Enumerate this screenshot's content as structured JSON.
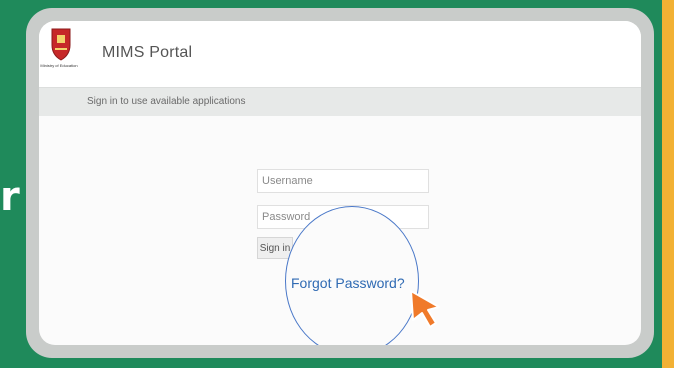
{
  "colors": {
    "background_green": "#1f8a5b",
    "accent_orange": "#f2b134",
    "link_blue": "#2f6ab3",
    "cursor_orange": "#f07a2a"
  },
  "header": {
    "logo_text": "Ministry of Education",
    "portal_title": "MIMS Portal"
  },
  "subbar": {
    "text": "Sign in to use available applications"
  },
  "login": {
    "username_placeholder": "Username",
    "password_placeholder": "Password",
    "signin_label": "Sign in",
    "forgot_label": "Forgot Password?"
  },
  "icons": {
    "logo": "crest-icon",
    "cursor": "pointer-cursor-icon"
  }
}
